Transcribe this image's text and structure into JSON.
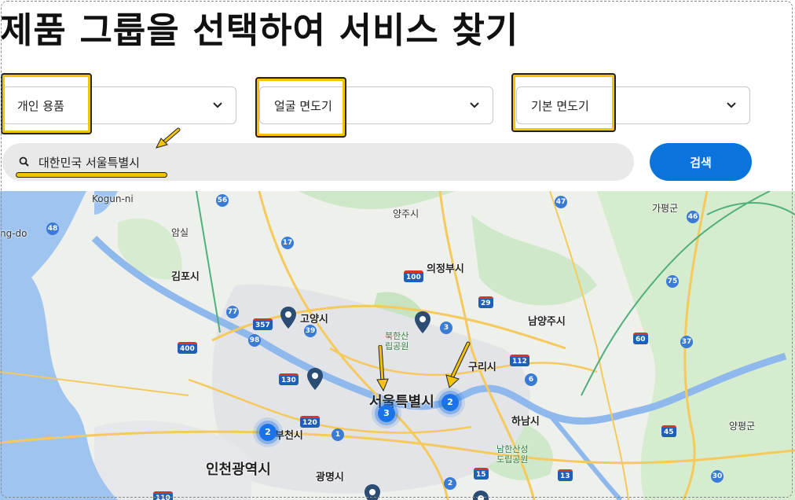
{
  "page": {
    "title": "제품 그룹을 선택하여 서비스 찾기"
  },
  "filters": {
    "product_group": "개인 용품",
    "category": "얼굴 면도기",
    "subcategory": "기본 면도기"
  },
  "search": {
    "value": "대한민국 서울특별시",
    "button_label": "검색"
  },
  "colors": {
    "accent": "#0a73dc",
    "highlight": "#f5c400",
    "cluster": "#1a73e8",
    "pin": "#2b4d73"
  },
  "map": {
    "labels": {
      "kogun": "Kogun-ni",
      "yangju": "양주시",
      "gapyeong": "가평군",
      "ungdo": "ng-do",
      "amsil": "암실",
      "uijeongbu": "의정부시",
      "gimpo": "김포시",
      "goyang": "고양시",
      "namyangju": "남양주시",
      "bukhansan": "북한산\n립공원",
      "guri": "구리시",
      "seoul": "서울특별시",
      "hanam": "하남시",
      "bucheon": "부천시",
      "incheon": "인천광역시",
      "gwangmyeong": "광명시",
      "namhansanseong": "남한산성\n도립공원",
      "yangpyeong": "양평군"
    },
    "clusters": [
      {
        "name": "seoul-center",
        "count": "3"
      },
      {
        "name": "seoul-east",
        "count": "2"
      },
      {
        "name": "bucheon",
        "count": "2"
      }
    ],
    "routes": [
      "48",
      "56",
      "17",
      "77",
      "357",
      "39",
      "400",
      "98",
      "130",
      "100",
      "120",
      "1",
      "110",
      "3",
      "29",
      "47",
      "46",
      "75",
      "112",
      "60",
      "6",
      "37",
      "45",
      "15",
      "2",
      "13",
      "30"
    ]
  }
}
